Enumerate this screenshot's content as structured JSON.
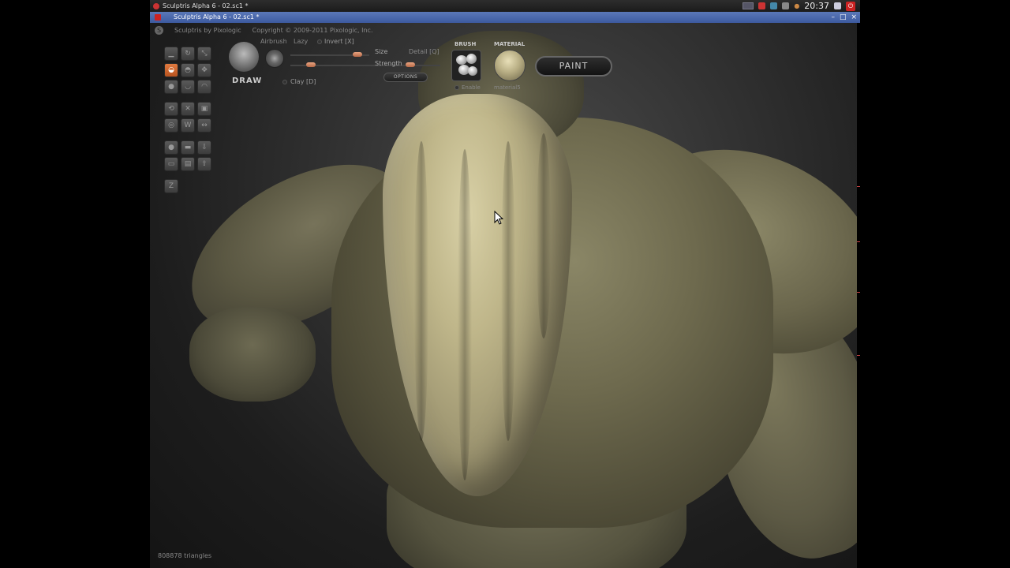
{
  "os": {
    "task_title": "Sculptris Alpha 6 - 02.sc1 *",
    "clock": "20:37"
  },
  "window": {
    "title": "Sculptris Alpha 6 - 02.sc1 *"
  },
  "app": {
    "brand": "Sculptris by Pixologic",
    "copyright": "Copyright © 2009-2011 Pixologic, Inc."
  },
  "toolbar": {
    "draw_label": "DRAW",
    "airbrush_label": "Airbrush",
    "lazy_label": "Lazy",
    "invert_label": "Invert [X]",
    "clay_label": "Clay [D]",
    "size_label": "Size",
    "detail_label": "Detail [Q]",
    "strength_label": "Strength",
    "options_label": "OPTIONS",
    "brush_heading": "BRUSH",
    "enable_label": "Enable",
    "material_heading": "MATERIAL",
    "material_name": "material5",
    "paint_label": "PAINT"
  },
  "tools": [
    {
      "name": "crease-tool",
      "icon": "crease-icon"
    },
    {
      "name": "rotate-tool",
      "icon": "rotate-icon"
    },
    {
      "name": "scale-tool",
      "icon": "scale-icon"
    },
    {
      "name": "draw-tool",
      "icon": "draw-icon",
      "active": true
    },
    {
      "name": "flatten-tool",
      "icon": "flatten-icon"
    },
    {
      "name": "grab-tool",
      "icon": "grab-icon"
    },
    {
      "name": "inflate-tool",
      "icon": "inflate-icon"
    },
    {
      "name": "pinch-tool",
      "icon": "pinch-icon"
    },
    {
      "name": "smooth-tool",
      "icon": "smooth-icon"
    },
    {
      "name": "reduce-tool",
      "icon": "reduce-icon"
    },
    {
      "name": "symmetry-tool",
      "icon": "symmetry-icon"
    },
    {
      "name": "mask-tool",
      "icon": "mask-icon"
    },
    {
      "name": "wireframe-tool",
      "icon": "wireframe-icon"
    },
    {
      "name": "mirror-tool",
      "icon": "mirror-icon"
    },
    {
      "name": "flip-tool",
      "icon": "flip-icon"
    },
    {
      "name": "new-sphere-tool",
      "icon": "sphere-icon"
    },
    {
      "name": "new-plane-tool",
      "icon": "plane-icon"
    },
    {
      "name": "import-tool",
      "icon": "import-icon"
    },
    {
      "name": "open-tool",
      "icon": "open-icon"
    },
    {
      "name": "save-tool",
      "icon": "save-icon"
    },
    {
      "name": "export-tool",
      "icon": "export-icon"
    },
    {
      "name": "goz-tool",
      "icon": "goz-icon"
    }
  ],
  "sliders": {
    "size": 0.85,
    "strength": 0.8
  },
  "status": {
    "triangles": "808878 triangles"
  }
}
